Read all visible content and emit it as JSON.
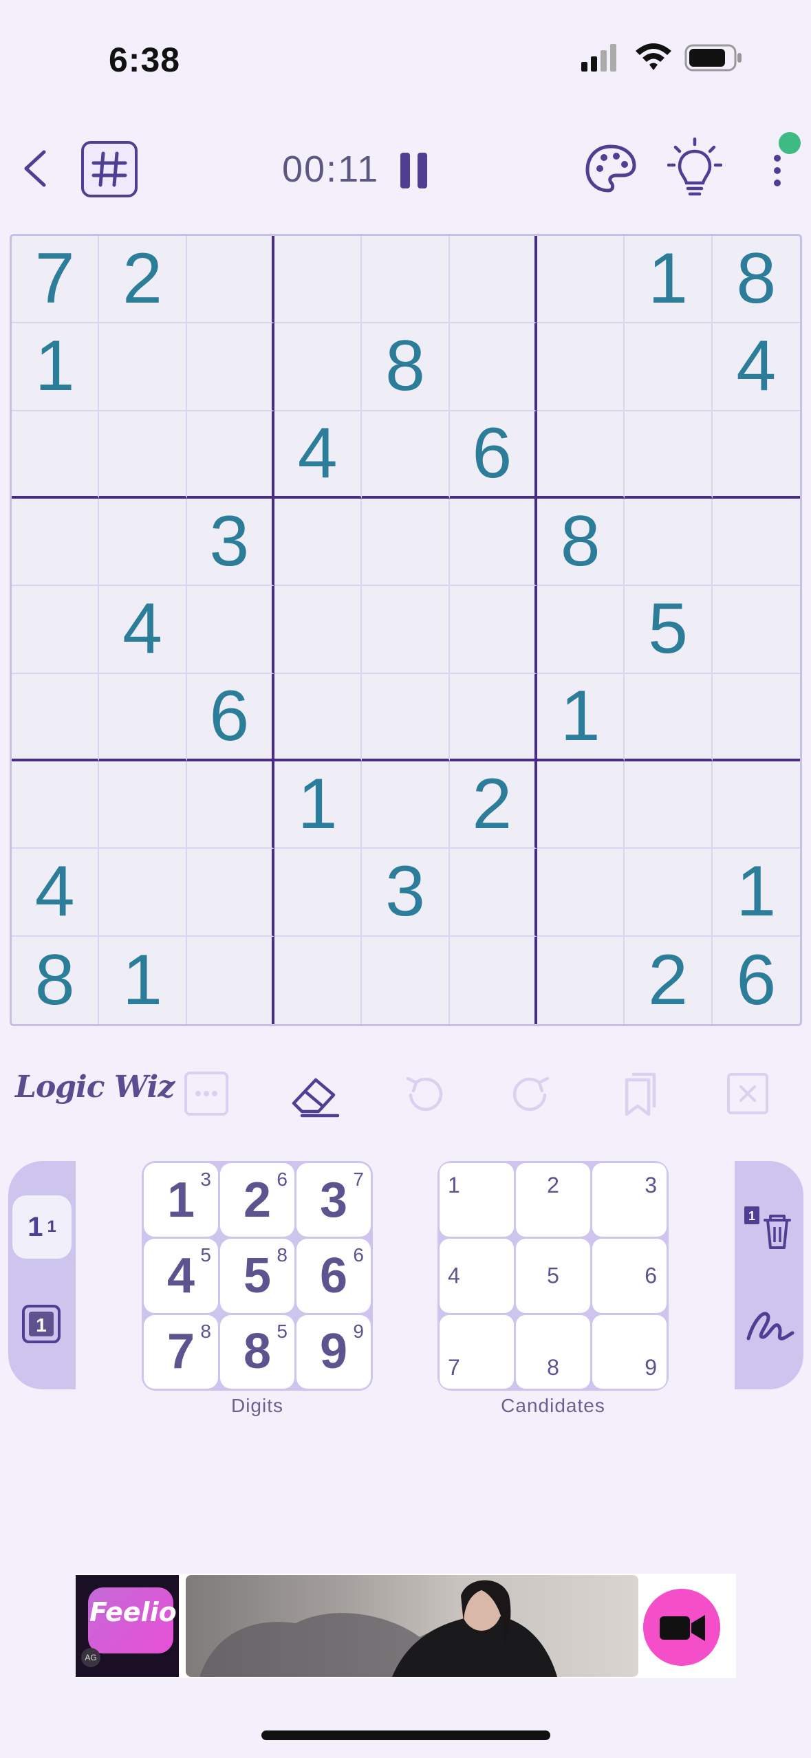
{
  "status_bar": {
    "time": "6:38"
  },
  "top_bar": {
    "timer": "00:11"
  },
  "board": {
    "grid": [
      [
        "7",
        "2",
        "",
        "",
        "",
        "",
        "",
        "1",
        "8"
      ],
      [
        "1",
        "",
        "",
        "",
        "8",
        "",
        "",
        "",
        "4"
      ],
      [
        "",
        "",
        "",
        "4",
        "",
        "6",
        "",
        "",
        ""
      ],
      [
        "",
        "",
        "3",
        "",
        "",
        "",
        "8",
        "",
        ""
      ],
      [
        "",
        "4",
        "",
        "",
        "",
        "",
        "",
        "5",
        ""
      ],
      [
        "",
        "",
        "6",
        "",
        "",
        "",
        "1",
        "",
        ""
      ],
      [
        "",
        "",
        "",
        "1",
        "",
        "2",
        "",
        "",
        ""
      ],
      [
        "4",
        "",
        "",
        "",
        "3",
        "",
        "",
        "",
        "1"
      ],
      [
        "8",
        "1",
        "",
        "",
        "",
        "",
        "",
        "2",
        "6"
      ]
    ]
  },
  "toolbar": {
    "logo": "Logic Wiz"
  },
  "mode_panel": {
    "normal_label": "1",
    "normal_sup": "1"
  },
  "digits": {
    "label": "Digits",
    "keys": [
      {
        "digit": "1",
        "remaining": "3"
      },
      {
        "digit": "2",
        "remaining": "6"
      },
      {
        "digit": "3",
        "remaining": "7"
      },
      {
        "digit": "4",
        "remaining": "5"
      },
      {
        "digit": "5",
        "remaining": "8"
      },
      {
        "digit": "6",
        "remaining": "6"
      },
      {
        "digit": "7",
        "remaining": "8"
      },
      {
        "digit": "8",
        "remaining": "5"
      },
      {
        "digit": "9",
        "remaining": "9"
      }
    ]
  },
  "candidates": {
    "label": "Candidates",
    "keys": [
      "1",
      "2",
      "3",
      "4",
      "5",
      "6",
      "7",
      "8",
      "9"
    ]
  },
  "ad": {
    "brand": "Feelio",
    "badge": "AG"
  },
  "colors": {
    "accent": "#4e3f92",
    "digit_given": "#2b7d9a",
    "panel": "#cdc5ee",
    "background": "#f4f0fb"
  }
}
